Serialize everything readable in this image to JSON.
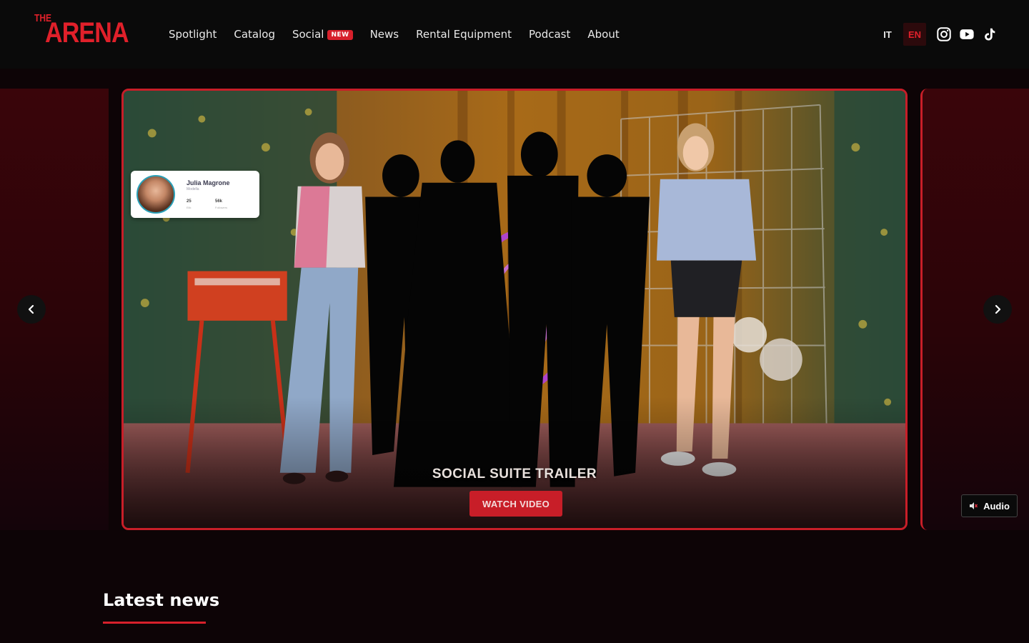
{
  "header": {
    "logo": {
      "small": "THE",
      "main": "ARENA"
    },
    "nav": [
      {
        "label": "Spotlight"
      },
      {
        "label": "Catalog"
      },
      {
        "label": "Social",
        "badge": "NEW"
      },
      {
        "label": "News"
      },
      {
        "label": "Rental Equipment"
      },
      {
        "label": "Podcast"
      },
      {
        "label": "About"
      }
    ],
    "languages": [
      {
        "code": "IT",
        "active": false
      },
      {
        "code": "EN",
        "active": true
      }
    ],
    "socials": [
      "instagram-icon",
      "youtube-icon",
      "tiktok-icon"
    ]
  },
  "carousel": {
    "slide": {
      "title": "SOCIAL SUITE TRAILER",
      "button": "WATCH VIDEO",
      "profile_card": {
        "name": "Julia Magrone",
        "role": "Modella",
        "stat1": "25",
        "stat1_label": "Elik",
        "stat2": "56k",
        "stat2_label": "Followers"
      }
    },
    "audio_label": "Audio",
    "prev_icon": "chevron-left-icon",
    "next_icon": "chevron-right-icon"
  },
  "news": {
    "heading": "Latest news"
  },
  "colors": {
    "accent": "#d7202b",
    "background": "#0d0406",
    "header": "#0a0a0a"
  }
}
